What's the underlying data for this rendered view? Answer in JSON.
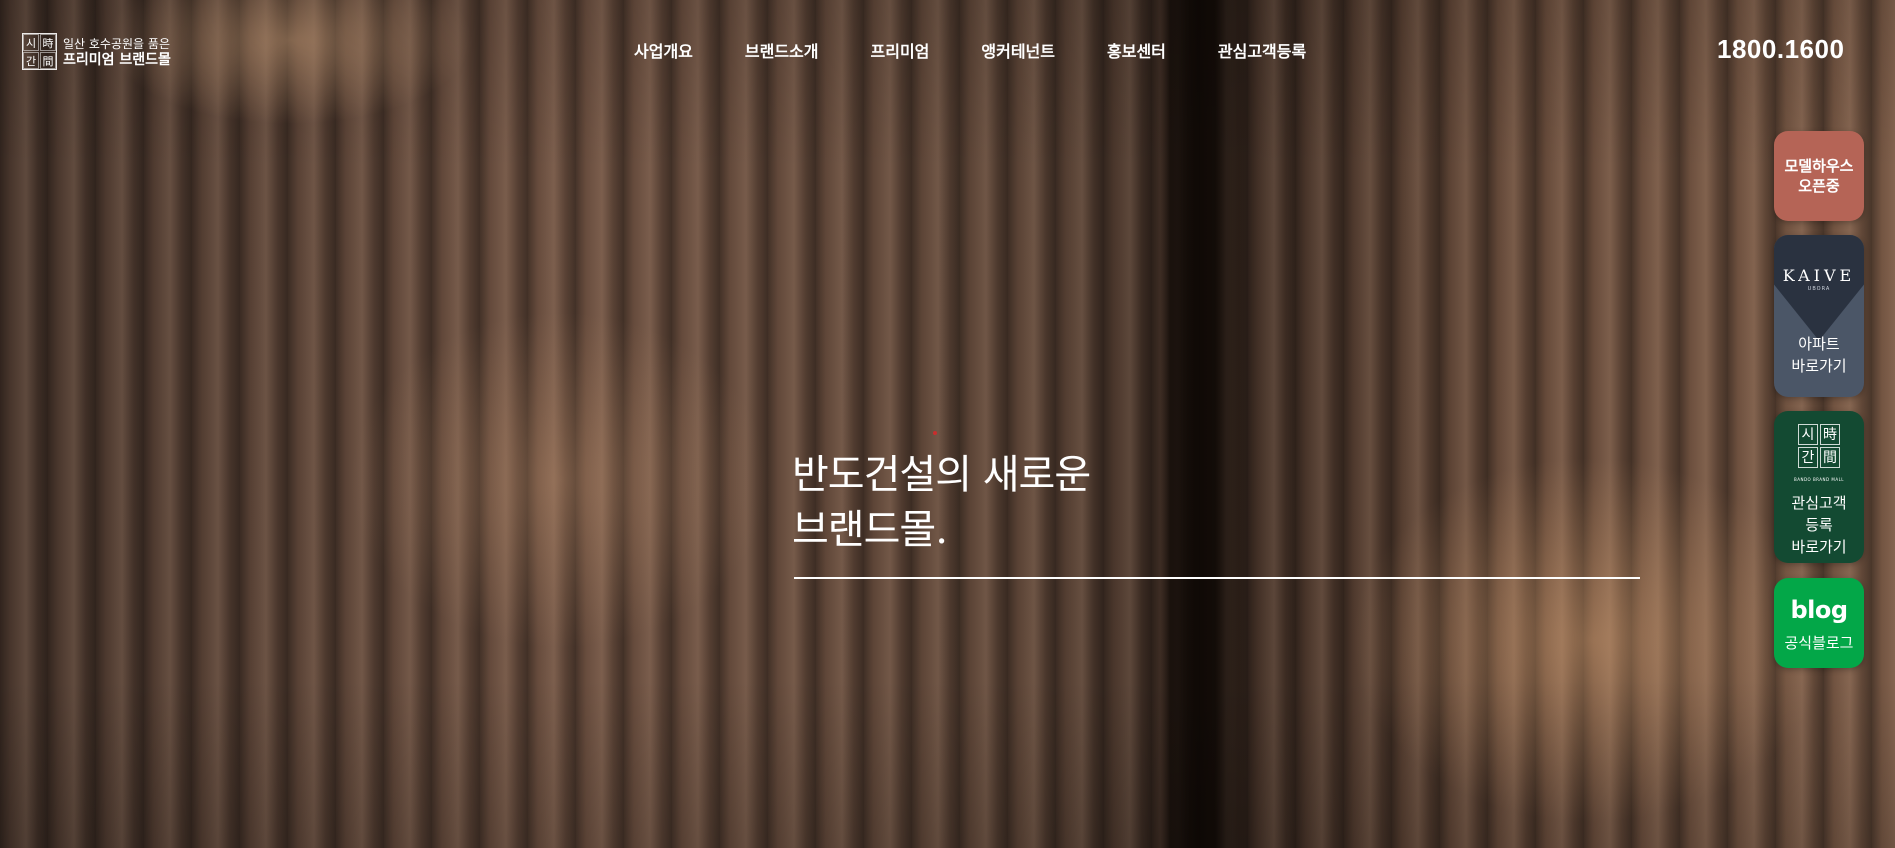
{
  "logo": {
    "mark": [
      "시",
      "時",
      "간",
      "間"
    ],
    "sub": "일산 호수공원을 품은",
    "main": "프리미엄 브랜드몰"
  },
  "nav": {
    "items": [
      "사업개요",
      "브랜드소개",
      "프리미엄",
      "앵커테넌트",
      "홍보센터",
      "관심고객등록"
    ]
  },
  "phone": "1800.1600",
  "hero": {
    "title_line1": "반도건설의 새로운",
    "title_line2": "브랜드몰."
  },
  "quick_menu": {
    "model_house": {
      "line1": "모델하우스",
      "line2": "오픈중",
      "color": "#b56456"
    },
    "kaive": {
      "brand": "KAIVE",
      "brand_sub": "UBORA",
      "line1": "아파트",
      "line2": "바로가기",
      "color": "#4b5667"
    },
    "interest": {
      "mark": [
        "시",
        "時",
        "간",
        "間"
      ],
      "mark_sub": "BANDO BRAND MALL",
      "line1": "관심고객",
      "line2": "등록",
      "line3": "바로가기",
      "color": "#134a32"
    },
    "blog": {
      "brand": "blog",
      "label": "공식블로그",
      "color": "#03a748"
    }
  }
}
